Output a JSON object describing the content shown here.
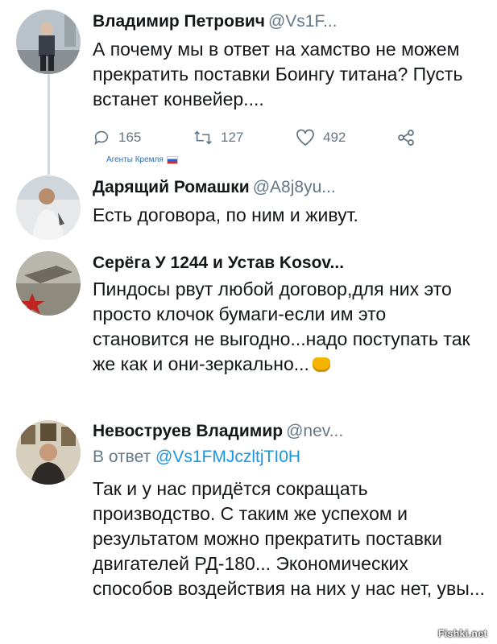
{
  "tweets": [
    {
      "name": "Владимир Петрович",
      "handle": "@Vs1F...",
      "text": "А почему мы в ответ на хамство не можем прекратить поставки Боингу титана? Пусть встанет конвейер....",
      "actions": {
        "reply_count": "165",
        "retweet_count": "127",
        "like_count": "492"
      }
    },
    {
      "badge": "Агенты Кремля",
      "name": "Дарящий Ромашки",
      "handle": "@A8j8yu...",
      "text": "Есть договора, по ним и живут."
    },
    {
      "name": "Серёга У 1244 и Устав Kosov...",
      "handle": "",
      "text": "Пиндосы рвут любой договор,для них это просто клочок бумаги-если им это становится не выгодно...надо поступать так же как и они-зеркально...",
      "emoji": "fist-emoji"
    },
    {
      "name": "Невоструев Владимир",
      "handle": "@nev...",
      "reply_prefix": "В ответ",
      "reply_mention": "@Vs1FMJczltjTI0H",
      "text": "Так и у нас придётся сокращать производство. С таким же успехом и результатом можно прекратить поставки двигателей РД-180... Экономических способов воздействия на них у нас нет, увы..."
    }
  ],
  "watermark": "Fishki.net",
  "colors": {
    "text": "#14171a",
    "secondary": "#657786",
    "link": "#1b95e0",
    "thread_line": "#cfd9de"
  },
  "icons": [
    "reply-icon",
    "retweet-icon",
    "like-icon",
    "share-icon",
    "russia-flag-icon",
    "fist-emoji"
  ]
}
